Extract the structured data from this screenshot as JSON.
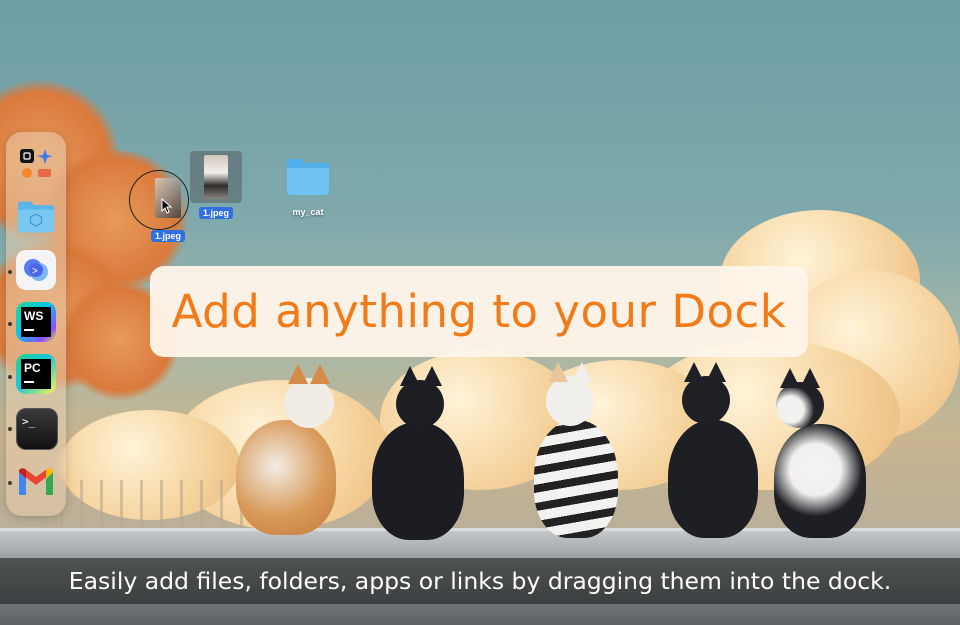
{
  "banner": {
    "title": "Add anything to your Dock"
  },
  "caption": {
    "text": "Easily add files, folders, apps or links by dragging them into the dock."
  },
  "desktop": {
    "items": [
      {
        "label": "1.jpeg",
        "kind": "image-file",
        "selected": true,
        "state": "dragging"
      },
      {
        "label": "1.jpeg",
        "kind": "image-file",
        "selected": true
      },
      {
        "label": "my_cat",
        "kind": "folder",
        "selected": false
      }
    ]
  },
  "dock": {
    "items": [
      {
        "name": "app-group",
        "icon": "app-grid-icon"
      },
      {
        "name": "folder",
        "icon": "folder-icon"
      },
      {
        "name": "app",
        "icon": "blue-app-icon"
      },
      {
        "name": "WebStorm",
        "icon": "ws-icon",
        "text": "WS"
      },
      {
        "name": "PyCharm",
        "icon": "pc-icon",
        "text": "PC"
      },
      {
        "name": "Terminal",
        "icon": "terminal-icon",
        "text": ">_"
      },
      {
        "name": "Gmail",
        "icon": "gmail-icon",
        "text": "M"
      }
    ]
  },
  "colors": {
    "accent": "#f27b17",
    "selection": "#2f6fe0"
  }
}
